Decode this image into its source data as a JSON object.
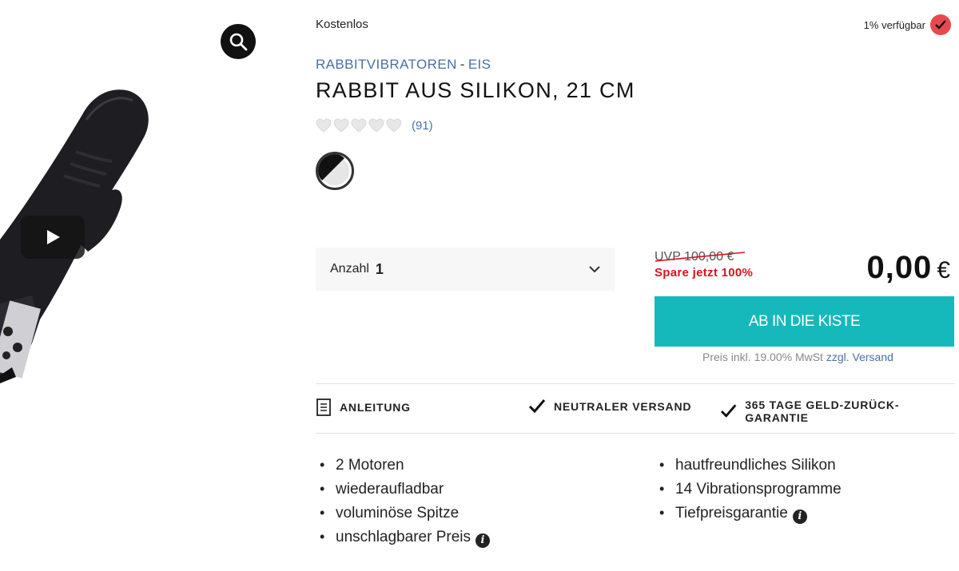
{
  "gallery": {
    "zoom_icon": "magnifier-icon",
    "play_icon": "play-icon"
  },
  "product": {
    "shipping": "Kostenlos",
    "availability": "1% verfügbar",
    "availability_color": "#e8484e",
    "category_main": "RABBITVIBRATOREN",
    "category_sep": "-",
    "category_sub": "EIS",
    "title": "RABBIT AUS SILIKON, 21 CM",
    "rating_hearts": 5,
    "review_count": "(91)",
    "color_option": "schwarz/weiß"
  },
  "purchase": {
    "quantity_label": "Anzahl",
    "quantity_value": "1",
    "uvp": "UVP 100,00 €",
    "saving": "Spare jetzt 100%",
    "price": "0,00",
    "currency": "€",
    "cart_button": "AB IN DIE KISTE",
    "cart_color": "#16b9bb",
    "tax_note": "Preis inkl. 19.00% MwSt",
    "tax_link_prefix": "zzgl.",
    "tax_link": "Versand"
  },
  "features": [
    {
      "icon": "document-icon",
      "label": "ANLEITUNG"
    },
    {
      "icon": "checkmark-icon",
      "label": "NEUTRALER VERSAND"
    },
    {
      "icon": "checkmark-icon",
      "label": "365 TAGE GELD-ZURÜCK-GARANTIE"
    }
  ],
  "bullets_left": [
    {
      "text": "2 Motoren"
    },
    {
      "text": "wiederaufladbar"
    },
    {
      "text": "voluminöse Spitze"
    },
    {
      "text": "unschlagbarer Preis",
      "info": true
    }
  ],
  "bullets_right": [
    {
      "text": "hautfreundliches Silikon"
    },
    {
      "text": "14 Vibrationsprogramme"
    },
    {
      "text": "Tiefpreisgarantie",
      "info": true
    }
  ]
}
